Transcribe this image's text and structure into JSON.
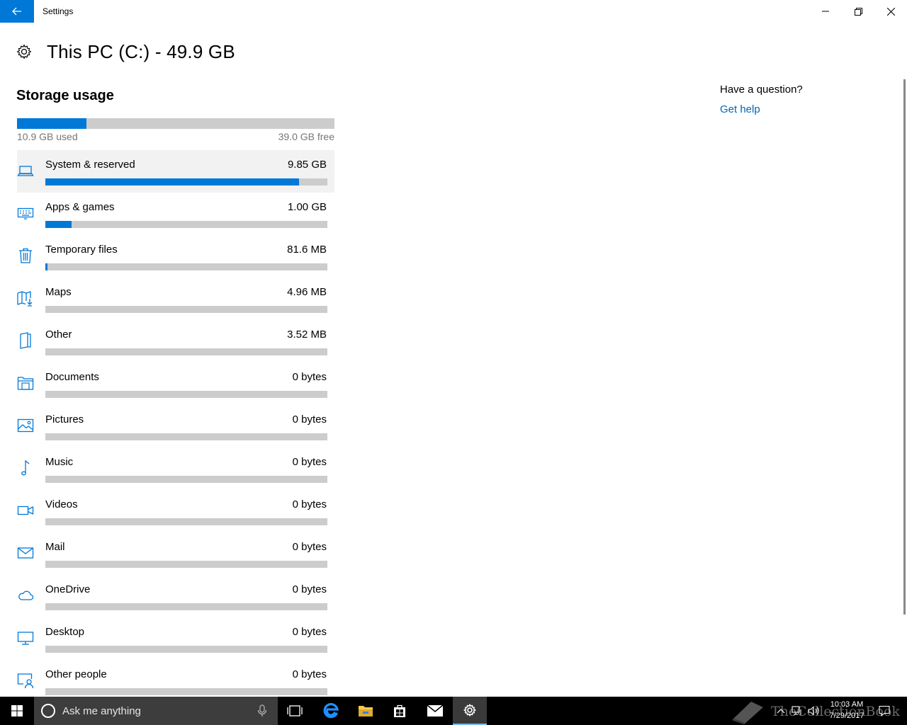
{
  "window": {
    "title": "Settings"
  },
  "header": {
    "title": "This PC (C:) - 49.9 GB"
  },
  "storage": {
    "section_title": "Storage usage",
    "used_label": "10.9 GB used",
    "free_label": "39.0 GB free",
    "used_fraction": 0.218
  },
  "categories": [
    {
      "icon": "laptop-icon",
      "name": "System & reserved",
      "size": "9.85 GB",
      "fraction": 0.9
    },
    {
      "icon": "keyboard-icon",
      "name": "Apps & games",
      "size": "1.00 GB",
      "fraction": 0.092
    },
    {
      "icon": "trash-icon",
      "name": "Temporary files",
      "size": "81.6 MB",
      "fraction": 0.008
    },
    {
      "icon": "map-download-icon",
      "name": "Maps",
      "size": "4.96 MB",
      "fraction": 0
    },
    {
      "icon": "other-file-icon",
      "name": "Other",
      "size": "3.52 MB",
      "fraction": 0
    },
    {
      "icon": "documents-icon",
      "name": "Documents",
      "size": "0 bytes",
      "fraction": 0
    },
    {
      "icon": "pictures-icon",
      "name": "Pictures",
      "size": "0 bytes",
      "fraction": 0
    },
    {
      "icon": "music-icon",
      "name": "Music",
      "size": "0 bytes",
      "fraction": 0
    },
    {
      "icon": "videos-icon",
      "name": "Videos",
      "size": "0 bytes",
      "fraction": 0
    },
    {
      "icon": "mail-icon",
      "name": "Mail",
      "size": "0 bytes",
      "fraction": 0
    },
    {
      "icon": "onedrive-icon",
      "name": "OneDrive",
      "size": "0 bytes",
      "fraction": 0
    },
    {
      "icon": "desktop-icon",
      "name": "Desktop",
      "size": "0 bytes",
      "fraction": 0
    },
    {
      "icon": "other-people-icon",
      "name": "Other people",
      "size": "0 bytes",
      "fraction": 0
    }
  ],
  "help": {
    "question": "Have a question?",
    "link": "Get help"
  },
  "taskbar": {
    "search_placeholder": "Ask me anything",
    "time": "10:03 AM",
    "date": "7/29/2017",
    "watermark": "TheCollectionBook"
  },
  "colors": {
    "accent": "#0078d7",
    "bar_track": "#cccccc",
    "link": "#0067b8"
  }
}
